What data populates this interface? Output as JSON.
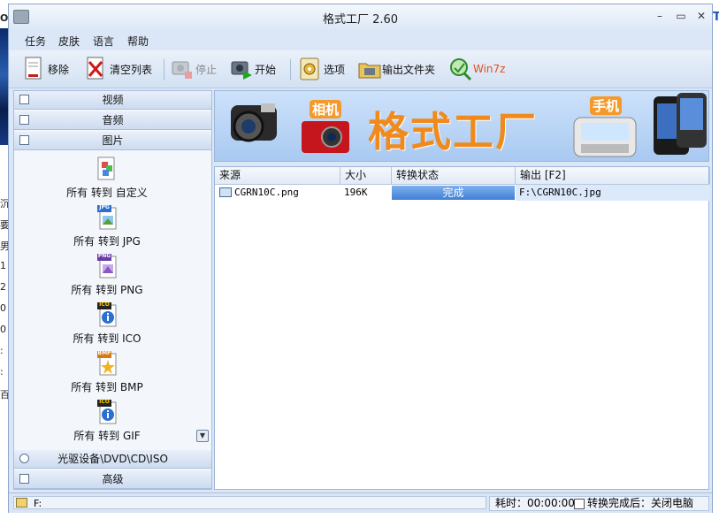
{
  "window": {
    "title": "格式工厂 2.60"
  },
  "menu": [
    "任务",
    "皮肤",
    "语言",
    "帮助"
  ],
  "toolbar": {
    "remove": "移除",
    "clear_list": "清空列表",
    "stop": "停止",
    "start": "开始",
    "options": "选项",
    "output_folder": "输出文件夹",
    "win7z": "Win7z"
  },
  "categories": {
    "video": "视频",
    "audio": "音频",
    "picture": "图片",
    "disc": "光驱设备\\DVD\\CD\\ISO",
    "advanced": "高级"
  },
  "picture_items": [
    {
      "label": "所有 转到 自定义",
      "badge": ""
    },
    {
      "label": "所有 转到 JPG",
      "badge": "JPG"
    },
    {
      "label": "所有 转到 PNG",
      "badge": "PNG"
    },
    {
      "label": "所有 转到 ICO",
      "badge": "ICO"
    },
    {
      "label": "所有 转到 BMP",
      "badge": "BMP"
    },
    {
      "label": "所有 转到 GIF",
      "badge": "ICO"
    }
  ],
  "banner": {
    "title": "格式工厂",
    "tag_camera": "相机",
    "tag_phone": "手机"
  },
  "list": {
    "columns": [
      "来源",
      "大小",
      "转换状态",
      "输出 [F2]"
    ],
    "rows": [
      {
        "source": "CGRN10C.png",
        "size": "196K",
        "status": "完成",
        "progress": 1.0,
        "output": "F:\\CGRN10C.jpg"
      }
    ]
  },
  "status": {
    "path": "F:",
    "elapsed": "耗时：00:00:00",
    "after_label": "转换完成后：关闭电脑"
  },
  "colors": {
    "accent": "#f08a1c",
    "progress": "#3f7fd4",
    "frame": "#dbe7f7"
  },
  "bg_fragments": [
    "Or",
    "沉",
    "要",
    "男",
    "1",
    "2",
    "0",
    "0",
    ":",
    ":",
    "百"
  ],
  "bg_right": "T"
}
